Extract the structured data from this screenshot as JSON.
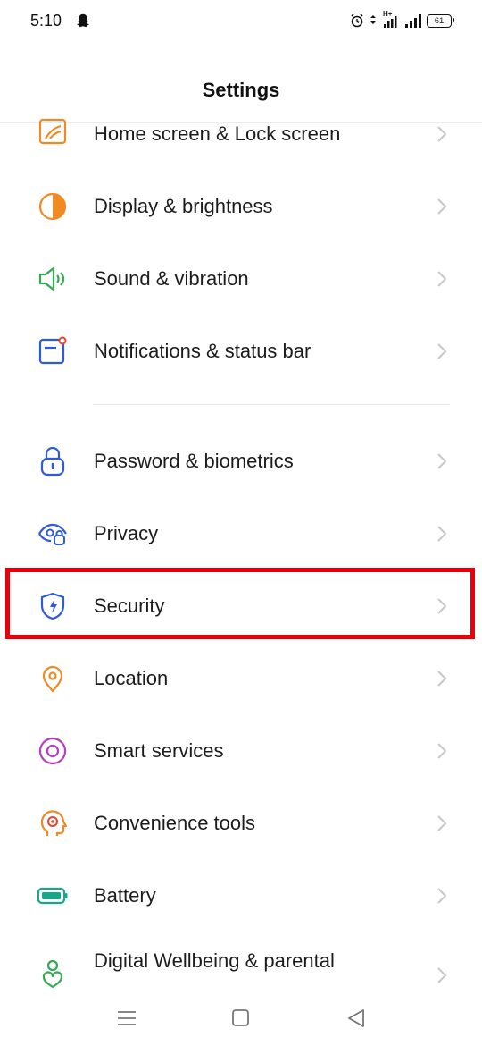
{
  "status_bar": {
    "time": "5:10",
    "network_label": "H+",
    "battery_level": "61"
  },
  "header": {
    "title": "Settings"
  },
  "settings_items": [
    {
      "label": "Home screen & Lock screen",
      "icon": "home-lock-icon"
    },
    {
      "label": "Display & brightness",
      "icon": "brightness-icon"
    },
    {
      "label": "Sound & vibration",
      "icon": "speaker-icon"
    },
    {
      "label": "Notifications & status bar",
      "icon": "notification-icon"
    },
    {
      "label": "Password & biometrics",
      "icon": "lock-icon"
    },
    {
      "label": "Privacy",
      "icon": "eye-lock-icon"
    },
    {
      "label": "Security",
      "icon": "shield-icon"
    },
    {
      "label": "Location",
      "icon": "location-pin-icon"
    },
    {
      "label": "Smart services",
      "icon": "target-icon"
    },
    {
      "label": "Convenience tools",
      "icon": "head-icon"
    },
    {
      "label": "Battery",
      "icon": "battery-icon"
    },
    {
      "label": "Digital Wellbeing & parental",
      "icon": "wellbeing-icon"
    }
  ],
  "highlighted_item": "Security",
  "colors": {
    "highlight_border": "#e8000b",
    "orange_icon": "#f08a24",
    "green_icon": "#34a853",
    "blue_icon": "#2f5bd6",
    "purple_icon": "#b33fbf",
    "teal_icon": "#17a88a"
  },
  "nav_bar": {
    "icons": [
      "menu-icon",
      "home-square-icon",
      "back-triangle-icon"
    ]
  }
}
